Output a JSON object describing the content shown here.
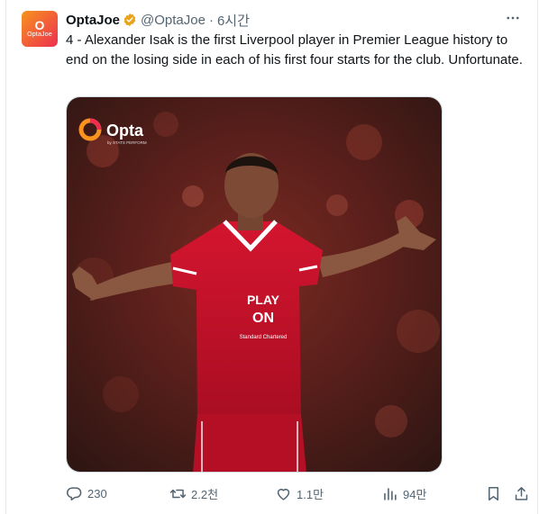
{
  "avatar": {
    "line1": "O",
    "line2": "OptaJoe"
  },
  "tweet": {
    "display_name": "OptaJoe",
    "handle": "@OptaJoe",
    "separator": "·",
    "time": "6시간",
    "text": "4 - Alexander Isak is the first Liverpool player in Premier League history to end on the losing side in each of his first four starts for the club. Unfortunate."
  },
  "media": {
    "logo_text": "Opta",
    "logo_sub": "by STATS PERFORM",
    "shirt_sponsor_1": "PLAY",
    "shirt_sponsor_2": "ON",
    "shirt_sponsor_3": "Standard Chartered"
  },
  "actions": {
    "replies": "230",
    "reposts": "2.2천",
    "likes": "1.1만",
    "views": "94만"
  },
  "icons": [
    "verified-icon",
    "more-icon",
    "reply-icon",
    "repost-icon",
    "like-icon",
    "views-icon",
    "bookmark-icon",
    "share-icon"
  ],
  "colors": {
    "verified": "#e8a317",
    "muted": "#536471",
    "jersey": "#c8102e"
  }
}
